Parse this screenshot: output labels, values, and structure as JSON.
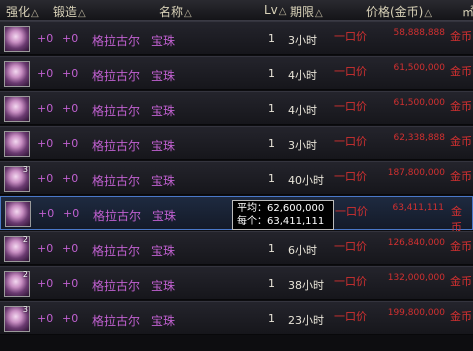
{
  "header": {
    "enhance": "强化",
    "forge": "锻造",
    "name": "名称",
    "level": "Lv",
    "period": "期限",
    "price": "价格(金币)",
    "sort_icon": "△",
    "edge_glyph": "㎡"
  },
  "rows": [
    {
      "qty": "",
      "enhance": "+0",
      "forge": "+0",
      "item": "格拉古尔",
      "type": "宝珠",
      "lv": "1",
      "period": "3小时",
      "price_type": "一口价",
      "price": "58,888,888",
      "unit": "金币"
    },
    {
      "qty": "",
      "enhance": "+0",
      "forge": "+0",
      "item": "格拉古尔",
      "type": "宝珠",
      "lv": "1",
      "period": "4小时",
      "price_type": "一口价",
      "price": "61,500,000",
      "unit": "金币"
    },
    {
      "qty": "",
      "enhance": "+0",
      "forge": "+0",
      "item": "格拉古尔",
      "type": "宝珠",
      "lv": "1",
      "period": "4小时",
      "price_type": "一口价",
      "price": "61,500,000",
      "unit": "金币"
    },
    {
      "qty": "",
      "enhance": "+0",
      "forge": "+0",
      "item": "格拉古尔",
      "type": "宝珠",
      "lv": "1",
      "period": "3小时",
      "price_type": "一口价",
      "price": "62,338,888",
      "unit": "金币"
    },
    {
      "qty": "3",
      "enhance": "+0",
      "forge": "+0",
      "item": "格拉古尔",
      "type": "宝珠",
      "lv": "1",
      "period": "40小时",
      "price_type": "一口价",
      "price": "187,800,000",
      "unit": "金币"
    },
    {
      "qty": "",
      "enhance": "+0",
      "forge": "+0",
      "item": "格拉古尔",
      "type": "宝珠",
      "lv": "1",
      "period": "",
      "price_type": "一口价",
      "price": "63,411,111",
      "unit": "金币"
    },
    {
      "qty": "2",
      "enhance": "+0",
      "forge": "+0",
      "item": "格拉古尔",
      "type": "宝珠",
      "lv": "1",
      "period": "6小时",
      "price_type": "一口价",
      "price": "126,840,000",
      "unit": "金币"
    },
    {
      "qty": "2",
      "enhance": "+0",
      "forge": "+0",
      "item": "格拉古尔",
      "type": "宝珠",
      "lv": "1",
      "period": "38小时",
      "price_type": "一口价",
      "price": "132,000,000",
      "unit": "金币"
    },
    {
      "qty": "3",
      "enhance": "+0",
      "forge": "+0",
      "item": "格拉古尔",
      "type": "宝珠",
      "lv": "1",
      "period": "23小时",
      "price_type": "一口价",
      "price": "199,800,000",
      "unit": "金币"
    }
  ],
  "tooltip": {
    "avg_label": "平均：",
    "avg_value": "62,600,000",
    "each_label": "每个：",
    "each_value": "63,411,111"
  },
  "colors": {
    "enhance_text": "#c060d0",
    "price_text": "#d23030",
    "selection_border": "#4a78c8"
  }
}
